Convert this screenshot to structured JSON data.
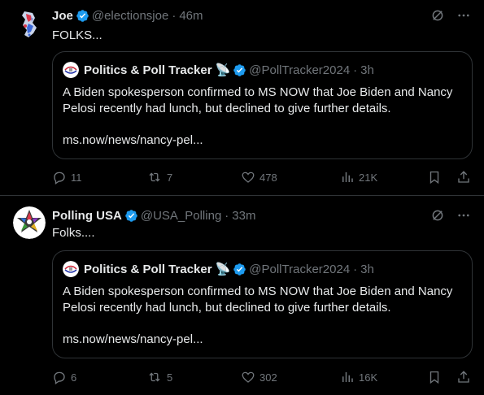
{
  "tweets": [
    {
      "name": "Joe",
      "handle": "@electionsjoe",
      "dot": "·",
      "time": "46m",
      "text": "FOLKS...",
      "quote": {
        "name": "Politics & Poll Tracker",
        "emoji": "📡",
        "handle": "@PollTracker2024",
        "dot": "·",
        "time": "3h",
        "body": "A Biden spokesperson confirmed to MS NOW that Joe Biden and Nancy Pelosi recently had lunch, but declined to give further details.",
        "link": "ms.now/news/nancy-pel..."
      },
      "actions": {
        "replies": "11",
        "reposts": "7",
        "likes": "478",
        "views": "21K"
      }
    },
    {
      "name": "Polling USA",
      "handle": "@USA_Polling",
      "dot": "·",
      "time": "33m",
      "text": "Folks....",
      "quote": {
        "name": "Politics & Poll Tracker",
        "emoji": "📡",
        "handle": "@PollTracker2024",
        "dot": "·",
        "time": "3h",
        "body": "A Biden spokesperson confirmed to MS NOW that Joe Biden and Nancy Pelosi recently had lunch, but declined to give further details.",
        "link": "ms.now/news/nancy-pel..."
      },
      "actions": {
        "replies": "6",
        "reposts": "5",
        "likes": "302",
        "views": "16K"
      }
    }
  ],
  "colors": {
    "background": "#000000",
    "text": "#e7e9ea",
    "muted": "#71767b",
    "verified": "#1d9bf0",
    "border": "#2f3336"
  },
  "icons": [
    "verified-badge-icon",
    "grok-icon",
    "more-icon",
    "reply-icon",
    "repost-icon",
    "like-icon",
    "views-icon",
    "bookmark-icon",
    "share-icon"
  ]
}
